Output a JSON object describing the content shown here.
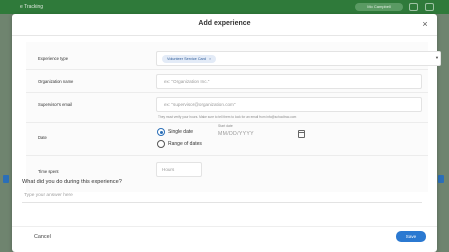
{
  "background": {
    "brand": "e Tracking",
    "pill_label": "Mo Campbell"
  },
  "modal": {
    "title": "Add experience",
    "close_glyph": "×"
  },
  "form": {
    "experience_type": {
      "label": "Experience type",
      "chip": "Volunteer Service Card",
      "chip_remove": "×",
      "caret": "▼"
    },
    "organization_name": {
      "label": "Organization name",
      "placeholder": "ex: \"Organization Inc.\""
    },
    "supervisor_email": {
      "label": "Supervisor's email",
      "placeholder": "ex: \"supervisor@organization.com\"",
      "help": "They must verify your hours. Make sure to tell them to look for an email from info@schooltrac.com"
    },
    "date": {
      "label": "Date",
      "option_single": "Single date",
      "option_range": "Range of dates",
      "start_label": "Start date",
      "start_placeholder": "MM/DD/YYYY"
    },
    "time_spent": {
      "label": "Time spent",
      "placeholder": "Hours"
    }
  },
  "question": {
    "text": "What did you do during this experience?",
    "placeholder": "Type your answer here"
  },
  "footer": {
    "cancel": "Cancel",
    "save": "Save"
  },
  "colors": {
    "accent": "#2b79d1",
    "header_green": "#2f7a3a",
    "overlay": "#8a9a8a"
  }
}
